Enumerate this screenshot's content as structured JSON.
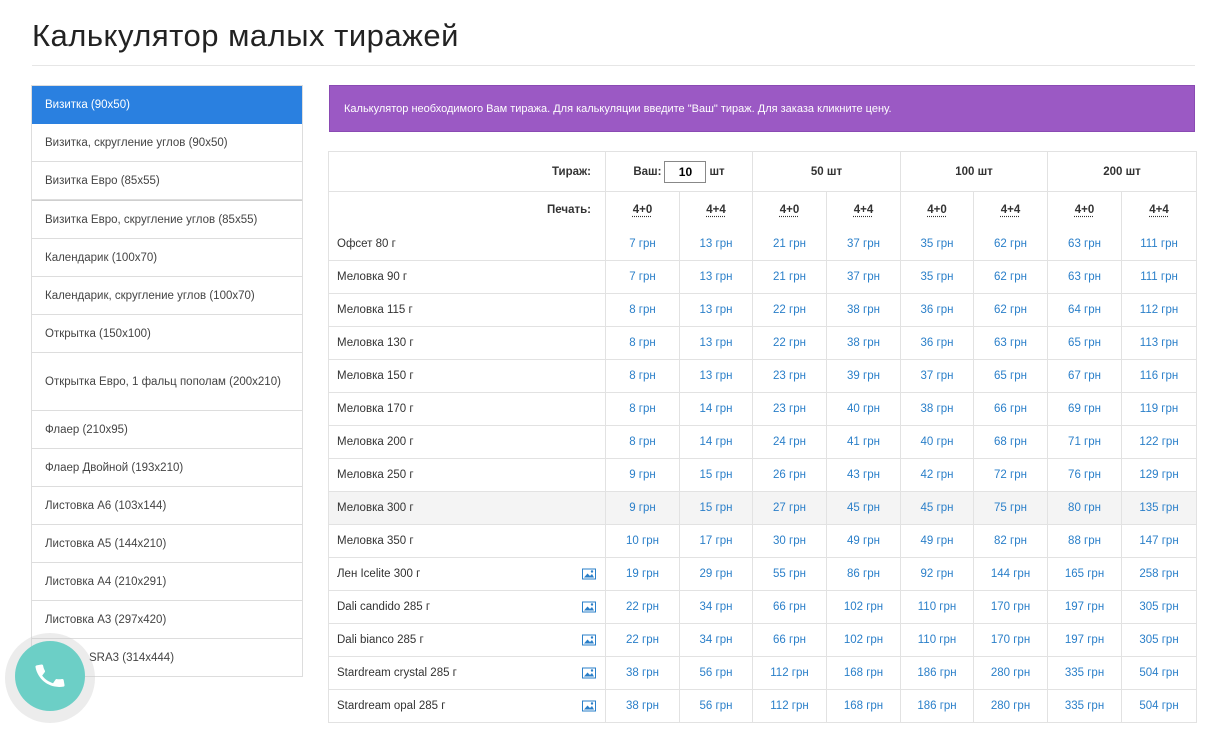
{
  "page": {
    "title": "Калькулятор малых тиражей"
  },
  "sidebar": {
    "items": [
      {
        "label": "Визитка (90x50)"
      },
      {
        "label": "Визитка, скругление углов (90x50)"
      },
      {
        "label": "Визитка Евро (85x55)"
      },
      {
        "label": "Визитка Евро, скругление углов (85x55)"
      },
      {
        "label": "Календарик (100x70)"
      },
      {
        "label": "Календарик, скругление углов (100x70)"
      },
      {
        "label": "Открытка (150x100)"
      },
      {
        "label": "Открытка Евро, 1 фальц пополам (200x210)"
      },
      {
        "label": "Флаер (210x95)"
      },
      {
        "label": "Флаер Двойной (193x210)"
      },
      {
        "label": "Листовка А6 (103x144)"
      },
      {
        "label": "Листовка А5 (144x210)"
      },
      {
        "label": "Листовка А4 (210x291)"
      },
      {
        "label": "Листовка А3 (297x420)"
      },
      {
        "label": "SRA3 (314x444)"
      }
    ],
    "active_index": 0,
    "active_color": "#2a80e0"
  },
  "banner": {
    "text": "Калькулятор необходимого Вам тиража. Для калькуляции введите \"Ваш\" тираж. Для заказа кликните цену.",
    "color": "#9b59c4"
  },
  "table": {
    "header": {
      "tirazh_label": "Тираж:",
      "custom_label": "Ваш:",
      "custom_value": "10",
      "unit": "шт",
      "qty_columns": [
        "50 шт",
        "100 шт",
        "200 шт"
      ],
      "print_label": "Печать:",
      "print_options": [
        "4+0",
        "4+4",
        "4+0",
        "4+4",
        "4+0",
        "4+4",
        "4+0",
        "4+4"
      ]
    },
    "rows": [
      {
        "paper": "Офсет 80 г",
        "image": false,
        "prices": [
          "7 грн",
          "13 грн",
          "21 грн",
          "37 грн",
          "35 грн",
          "62 грн",
          "63 грн",
          "111 грн"
        ]
      },
      {
        "paper": "Меловка 90 г",
        "image": false,
        "prices": [
          "7 грн",
          "13 грн",
          "21 грн",
          "37 грн",
          "35 грн",
          "62 грн",
          "63 грн",
          "111 грн"
        ]
      },
      {
        "paper": "Меловка 115 г",
        "image": false,
        "prices": [
          "8 грн",
          "13 грн",
          "22 грн",
          "38 грн",
          "36 грн",
          "62 грн",
          "64 грн",
          "112 грн"
        ]
      },
      {
        "paper": "Меловка 130 г",
        "image": false,
        "prices": [
          "8 грн",
          "13 грн",
          "22 грн",
          "38 грн",
          "36 грн",
          "63 грн",
          "65 грн",
          "113 грн"
        ]
      },
      {
        "paper": "Меловка 150 г",
        "image": false,
        "prices": [
          "8 грн",
          "13 грн",
          "23 грн",
          "39 грн",
          "37 грн",
          "65 грн",
          "67 грн",
          "116 грн"
        ]
      },
      {
        "paper": "Меловка 170 г",
        "image": false,
        "prices": [
          "8 грн",
          "14 грн",
          "23 грн",
          "40 грн",
          "38 грн",
          "66 грн",
          "69 грн",
          "119 грн"
        ]
      },
      {
        "paper": "Меловка 200 г",
        "image": false,
        "prices": [
          "8 грн",
          "14 грн",
          "24 грн",
          "41 грн",
          "40 грн",
          "68 грн",
          "71 грн",
          "122 грн"
        ]
      },
      {
        "paper": "Меловка 250 г",
        "image": false,
        "prices": [
          "9 грн",
          "15 грн",
          "26 грн",
          "43 грн",
          "42 грн",
          "72 грн",
          "76 грн",
          "129 грн"
        ]
      },
      {
        "paper": "Меловка 300 г",
        "image": false,
        "highlight": true,
        "prices": [
          "9 грн",
          "15 грн",
          "27 грн",
          "45 грн",
          "45 грн",
          "75 грн",
          "80 грн",
          "135 грн"
        ]
      },
      {
        "paper": "Меловка 350 г",
        "image": false,
        "prices": [
          "10 грн",
          "17 грн",
          "30 грн",
          "49 грн",
          "49 грн",
          "82 грн",
          "88 грн",
          "147 грн"
        ]
      },
      {
        "paper": "Лен Icelite 300 г",
        "image": true,
        "prices": [
          "19 грн",
          "29 грн",
          "55 грн",
          "86 грн",
          "92 грн",
          "144 грн",
          "165 грн",
          "258 грн"
        ]
      },
      {
        "paper": "Dali candido 285 г",
        "image": true,
        "prices": [
          "22 грн",
          "34 грн",
          "66 грн",
          "102 грн",
          "110 грн",
          "170 грн",
          "197 грн",
          "305 грн"
        ]
      },
      {
        "paper": "Dali bianco 285 г",
        "image": true,
        "prices": [
          "22 грн",
          "34 грн",
          "66 грн",
          "102 грн",
          "110 грн",
          "170 грн",
          "197 грн",
          "305 грн"
        ]
      },
      {
        "paper": "Stardream crystal 285 г",
        "image": true,
        "prices": [
          "38 грн",
          "56 грн",
          "112 грн",
          "168 грн",
          "186 грн",
          "280 грн",
          "335 грн",
          "504 грн"
        ]
      },
      {
        "paper": "Stardream opal 285 г",
        "image": true,
        "prices": [
          "38 грн",
          "56 грн",
          "112 грн",
          "168 грн",
          "186 грн",
          "280 грн",
          "335 грн",
          "504 грн"
        ]
      }
    ],
    "price_color": "#2a7fc9"
  },
  "phone_button": {
    "icon": "phone-icon",
    "color": "#6ccfc6"
  }
}
